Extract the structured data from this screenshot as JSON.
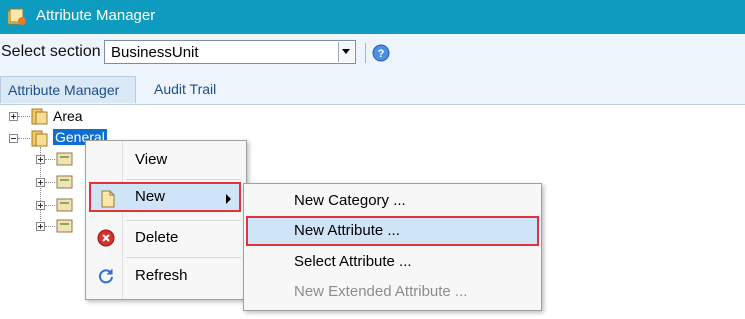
{
  "window": {
    "title": "Attribute Manager"
  },
  "section": {
    "label": "Select section",
    "value": "BusinessUnit"
  },
  "tabs": [
    {
      "label": "Attribute Manager",
      "active": true
    },
    {
      "label": "Audit Trail",
      "active": false
    }
  ],
  "tree": {
    "nodes": [
      {
        "label": "Area",
        "expanded": false
      },
      {
        "label": "General",
        "expanded": true,
        "selected": true
      }
    ]
  },
  "context_menu": {
    "items": [
      {
        "label": "View",
        "icon": ""
      },
      {
        "label": "New",
        "icon": "new-document-icon",
        "has_submenu": true,
        "highlighted": true
      },
      {
        "label": "Delete",
        "icon": "delete-icon"
      },
      {
        "label": "Refresh",
        "icon": "refresh-icon"
      }
    ]
  },
  "submenu": {
    "items": [
      {
        "label": "New Category ...",
        "enabled": true
      },
      {
        "label": "New Attribute ...",
        "enabled": true,
        "highlighted": true
      },
      {
        "label": "Select Attribute ...",
        "enabled": true
      },
      {
        "label": "New Extended Attribute ...",
        "enabled": false
      }
    ]
  },
  "colors": {
    "titlebar": "#0d9bbf",
    "highlight_border": "#e0333f",
    "highlight_fill": "#cfe4f7",
    "selection": "#0f6fd1",
    "tab_text": "#1b4e8d"
  }
}
